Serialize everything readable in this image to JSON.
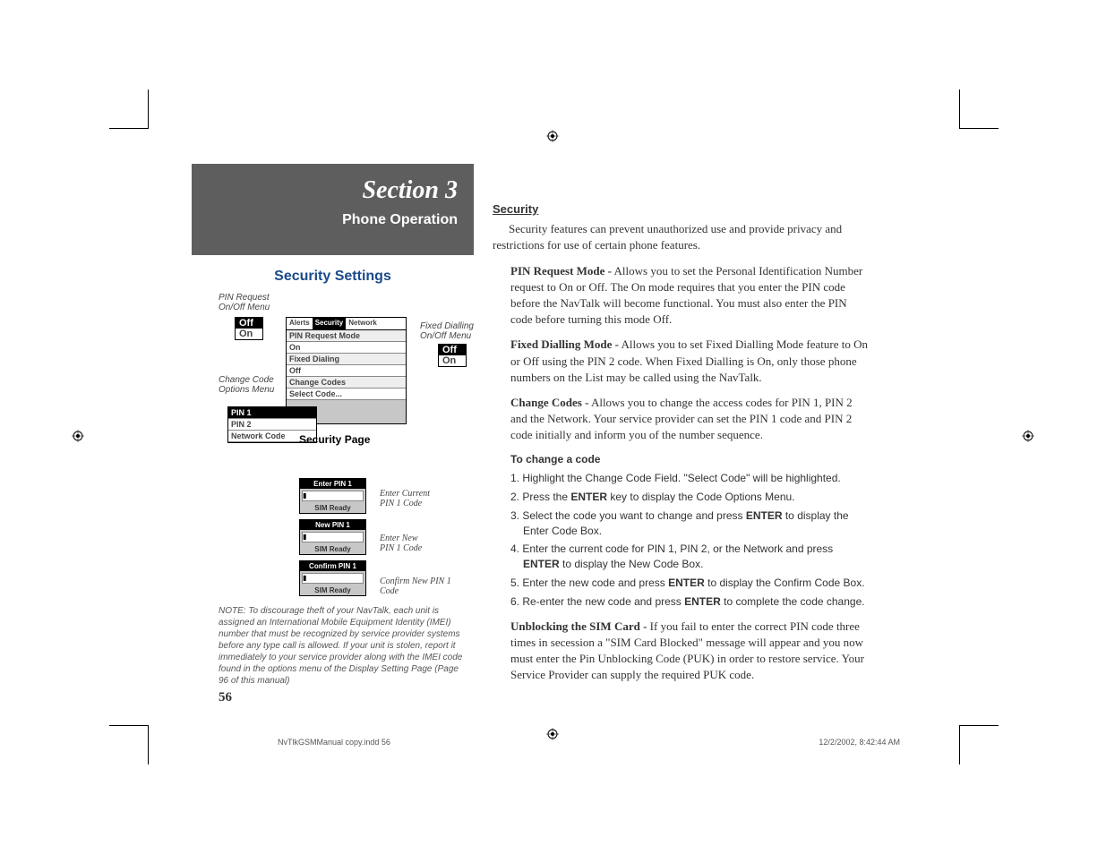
{
  "header": {
    "section_title": "Section 3",
    "subtitle": "Phone Operation"
  },
  "left": {
    "title": "Security Settings",
    "pin_request_label": "PIN Request\nOn/Off Menu",
    "fixed_dialling_label": "Fixed Dialling\nOn/Off Menu",
    "change_code_label": "Change Code\nOptions Menu",
    "security_page_label": "Security Page",
    "tabs": {
      "alerts": "Alerts",
      "security": "Security",
      "network": "Network"
    },
    "menu": {
      "pin_request": "PIN Request Mode",
      "on": "On",
      "fixed_dialing": "Fixed Dialing",
      "off": "Off",
      "change_codes": "Change Codes",
      "select_code": "Select Code..."
    },
    "code_menu": {
      "pin1": "PIN 1",
      "pin2": "PIN 2",
      "network": "Network Code"
    },
    "boxes": {
      "enter_pin": "Enter PIN 1",
      "new_pin": "New PIN 1",
      "confirm_pin": "Confirm PIN 1",
      "sim_ready": "SIM Ready"
    },
    "box_labels": {
      "enter_current": "Enter Current\nPIN 1 Code",
      "enter_new": "Enter New\nPIN 1 Code",
      "confirm": "Confirm New PIN 1\nCode"
    },
    "off": "Off",
    "on": "On",
    "note": "NOTE: To discourage theft of your NavTalk, each unit is assigned an International Mobile Equipment Identity (IMEI) number that must be recognized by service provider systems before any type call is allowed. If your unit is stolen, report it immediately to your service provider along with the IMEI code found in the options menu of the Display Setting Page (Page 96 of this manual)",
    "page_number": "56"
  },
  "right": {
    "heading": "Security",
    "intro": "Security features can prevent unauthorized use and provide privacy and restrictions for use of certain phone features.",
    "pin_request_label": "PIN Request Mode -",
    "pin_request_text": " Allows you to set the Personal Identification Number request to On or Off. The On mode requires that you enter the PIN code before the NavTalk will become functional. You must also enter the PIN code before turning this mode Off.",
    "fixed_dialling_label": "Fixed Dialling Mode -",
    "fixed_dialling_text": " Allows you to set Fixed Dialling Mode feature to On or Off using the PIN 2 code. When Fixed Dialling is On, only those phone numbers on the List may be called using the NavTalk.",
    "change_codes_label": "Change Codes -",
    "change_codes_text": " Allows you to change the access codes for PIN 1, PIN 2 and the Network. Your service provider can set the PIN 1 code and PIN 2 code initially and inform you of the number sequence.",
    "to_change_heading": "To change a code",
    "steps": [
      "1. Highlight the Change Code Field. \"Select Code\" will be highlighted.",
      "2. Press the ENTER key to display the Code Options Menu.",
      "3. Select the code you want to change and press ENTER to display the Enter Code Box.",
      "4. Enter the current code for PIN 1, PIN 2, or the Network and press ENTER to display the New Code Box.",
      "5. Enter the new code and press ENTER to display the Confirm Code Box.",
      "6. Re-enter the new code and press ENTER to complete the code change."
    ],
    "unblock_label": "Unblocking the SIM Card -",
    "unblock_text": " If you fail to enter the correct PIN code three times in secession a \"SIM Card Blocked\" message will appear and you now must enter the Pin Unblocking Code (PUK) in order to restore service. Your Service Provider can supply the required PUK code."
  },
  "footer": {
    "filename": "NvTlkGSMManual copy.indd   56",
    "timestamp": "12/2/2002, 8:42:44 AM"
  }
}
